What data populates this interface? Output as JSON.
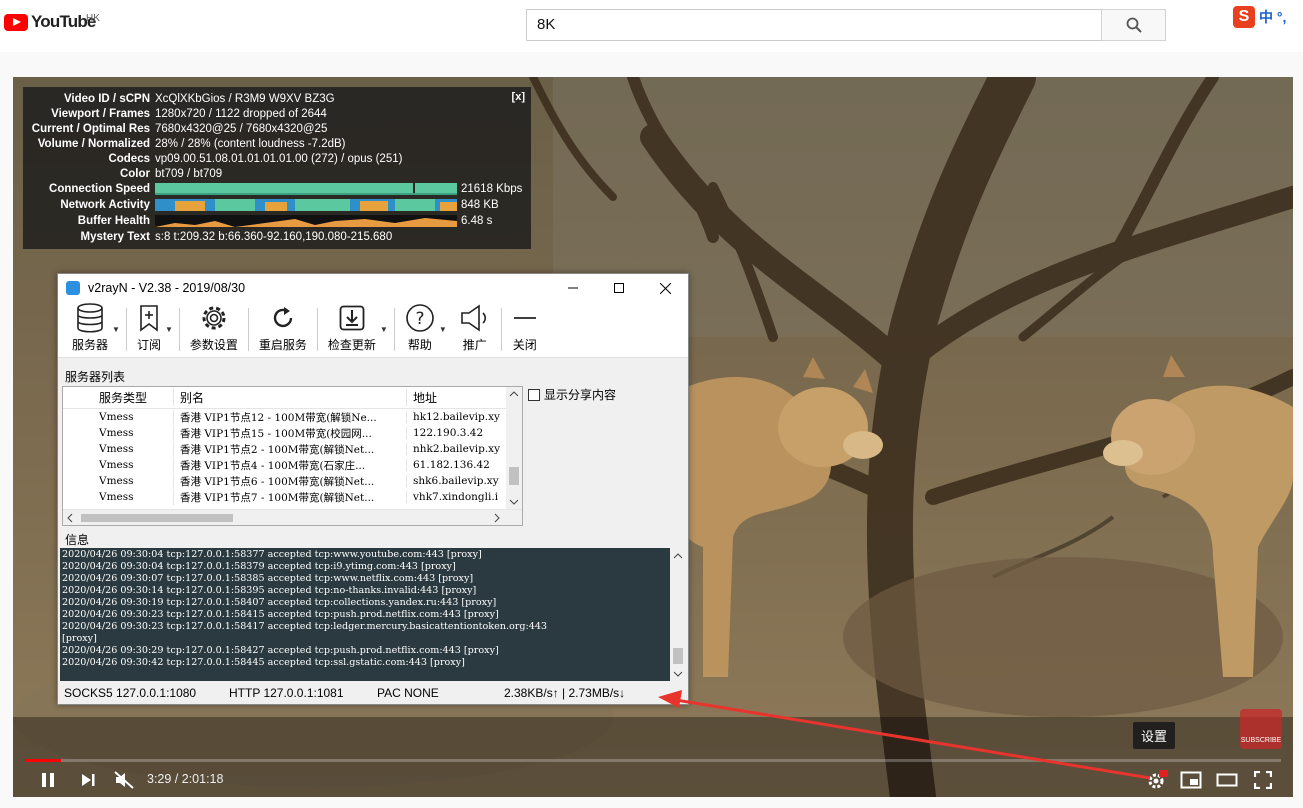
{
  "youtube": {
    "logo_text": "YouTube",
    "region": "HK",
    "search_value": "8K",
    "ime_label": "中 °,",
    "ime_logo": "S"
  },
  "stats": {
    "close": "[x]",
    "rows": [
      {
        "label": "Video ID / sCPN",
        "value": "XcQlXKbGios / R3M9 W9XV BZ3G"
      },
      {
        "label": "Viewport / Frames",
        "value": "1280x720 / 1122 dropped of 2644"
      },
      {
        "label": "Current / Optimal Res",
        "value": "7680x4320@25 / 7680x4320@25"
      },
      {
        "label": "Volume / Normalized",
        "value": "28% / 28% (content loudness -7.2dB)"
      },
      {
        "label": "Codecs",
        "value": "vp09.00.51.08.01.01.01.01.00 (272) / opus (251)"
      },
      {
        "label": "Color",
        "value": "bt709 / bt709"
      },
      {
        "label": "Connection Speed",
        "value": "21618 Kbps"
      },
      {
        "label": "Network Activity",
        "value": "848 KB"
      },
      {
        "label": "Buffer Health",
        "value": "6.48 s"
      },
      {
        "label": "Mystery Text",
        "value": "s:8 t:209.32 b:66.360-92.160,190.080-215.680"
      }
    ]
  },
  "v2ray": {
    "title": "v2rayN - V2.38 - 2019/08/30",
    "toolbar": {
      "servers": "服务器",
      "subscribe": "订阅",
      "settings": "参数设置",
      "restart": "重启服务",
      "update": "检查更新",
      "help": "帮助",
      "promo": "推广",
      "close": "关闭"
    },
    "server_list_label": "服务器列表",
    "share_label": "显示分享内容",
    "columns": {
      "type": "服务类型",
      "alias": "别名",
      "address": "地址"
    },
    "servers": [
      {
        "type": "Vmess",
        "alias": "香港 VIP1节点12 - 100M带宽(解锁Ne...",
        "address": "hk12.bailevip.xy"
      },
      {
        "type": "Vmess",
        "alias": "香港 VIP1节点15 - 100M带宽(校园网...",
        "address": "122.190.3.42"
      },
      {
        "type": "Vmess",
        "alias": "香港 VIP1节点2 - 100M带宽(解锁Net...",
        "address": "nhk2.bailevip.xy"
      },
      {
        "type": "Vmess",
        "alias": "香港 VIP1节点4 - 100M带宽(石家庄...",
        "address": "61.182.136.42"
      },
      {
        "type": "Vmess",
        "alias": "香港 VIP1节点6 - 100M带宽(解锁Net...",
        "address": "shk6.bailevip.xy"
      },
      {
        "type": "Vmess",
        "alias": "香港 VIP1节点7 - 100M带宽(解锁Net...",
        "address": "vhk7.xindongli.i"
      }
    ],
    "info_label": "信息",
    "log": [
      "2020/04/26 09:30:04 tcp:127.0.0.1:58377 accepted tcp:www.youtube.com:443 [proxy]",
      "2020/04/26 09:30:04 tcp:127.0.0.1:58379 accepted tcp:i9.ytimg.com:443 [proxy]",
      "2020/04/26 09:30:07 tcp:127.0.0.1:58385 accepted tcp:www.netflix.com:443 [proxy]",
      "2020/04/26 09:30:14 tcp:127.0.0.1:58395 accepted tcp:no-thanks.invalid:443 [proxy]",
      "2020/04/26 09:30:19 tcp:127.0.0.1:58407 accepted tcp:collections.yandex.ru:443 [proxy]",
      "2020/04/26 09:30:23 tcp:127.0.0.1:58415 accepted tcp:push.prod.netflix.com:443 [proxy]",
      "2020/04/26 09:30:23 tcp:127.0.0.1:58417 accepted tcp:ledger.mercury.basicattentiontoken.org:443",
      "[proxy]",
      "2020/04/26 09:30:29 tcp:127.0.0.1:58427 accepted tcp:push.prod.netflix.com:443 [proxy]",
      "2020/04/26 09:30:42 tcp:127.0.0.1:58445 accepted tcp:ssl.gstatic.com:443 [proxy]"
    ],
    "status": {
      "socks": "SOCKS5  127.0.0.1:1080",
      "http": "HTTP  127.0.0.1:1081",
      "pac": "PAC  NONE",
      "speed": "2.38KB/s↑ | 2.73MB/s↓"
    }
  },
  "player": {
    "time": "3:29 / 2:01:18",
    "progress": 0.029,
    "tooltip": "设置",
    "subscribe_wm": "SUBSCRIBE",
    "hd_badge": "8K"
  },
  "colors": {
    "accent": "#ff0000",
    "annotation_arrow": "#e8342c",
    "log_bg": "#2b3a40",
    "stats_bar": "#5cc8a0"
  }
}
